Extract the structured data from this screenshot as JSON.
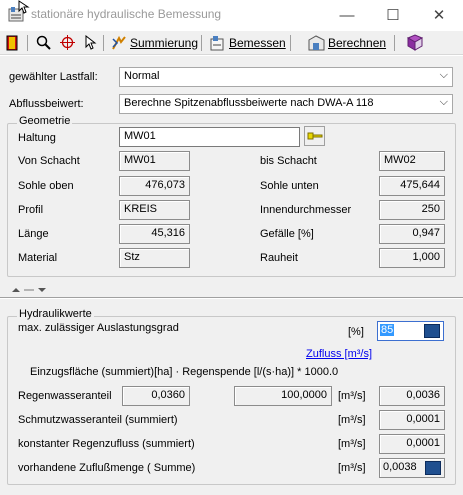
{
  "window": {
    "title": "stationäre hydraulische Bemessung",
    "minimize_glyph": "—",
    "maximize_glyph": "☐",
    "close_glyph": "✕"
  },
  "toolbar": {
    "summierung_label": "Summierung",
    "bemessen_label": "Bemessen",
    "berechnen_label": "Berechnen"
  },
  "form": {
    "lastfall_label": "gewählter Lastfall:",
    "lastfall_value": "Normal",
    "abfluss_label": "Abflussbeiwert:",
    "abfluss_value": "Berechne Spitzenabflussbeiwerte nach DWA-A 118"
  },
  "geometrie": {
    "title": "Geometrie",
    "haltung_label": "Haltung",
    "haltung_value": "MW01",
    "von_schacht_label": "Von Schacht",
    "von_schacht_value": "MW01",
    "bis_schacht_label": "bis Schacht",
    "bis_schacht_value": "MW02",
    "sohle_oben_label": "Sohle oben",
    "sohle_oben_value": "476,073",
    "sohle_unten_label": "Sohle unten",
    "sohle_unten_value": "475,644",
    "profil_label": "Profil",
    "profil_value": "KREIS",
    "innendurchmesser_label": "Innendurchmesser",
    "innendurchmesser_value": "250",
    "laenge_label": "Länge",
    "laenge_value": "45,316",
    "gefaelle_label": "Gefälle [%]",
    "gefaelle_value": "0,947",
    "material_label": "Material",
    "material_value": "Stz",
    "rauheit_label": "Rauheit",
    "rauheit_value": "1,000"
  },
  "hydraulik": {
    "title": "Hydraulikwerte",
    "auslastung_label": "max. zulässiger Auslastungsgrad",
    "auslastung_unit": "[%]",
    "auslastung_value": "85",
    "zufluss_link": "Zufluss [m³/s]",
    "formula_text": "Einzugsfläche (summiert)[ha] · Regenspende [l/(s·ha)] * 1000.0",
    "regenwasser_label": "Regenwasseranteil",
    "regenwasser_flaeche": "0,0360",
    "regenwasser_spende": "100,0000",
    "regenwasser_unit": "[m³/s]",
    "regenwasser_value": "0,0036",
    "schmutz_label": "Schmutzwasseranteil (summiert)",
    "schmutz_unit": "[m³/s]",
    "schmutz_value": "0,0001",
    "regenzufluss_label": "konstanter Regenzufluss (summiert)",
    "regenzufluss_unit": "[m³/s]",
    "regenzufluss_value": "0,0001",
    "zufluss_label": "vorhandene Zuflußmenge ( Summe)",
    "zufluss_unit": "[m³/s]",
    "zufluss_value": "0,0038"
  },
  "colors": {
    "accent": "#0000ee",
    "panel": "#f0f0f0",
    "selection": "#3399ff"
  }
}
